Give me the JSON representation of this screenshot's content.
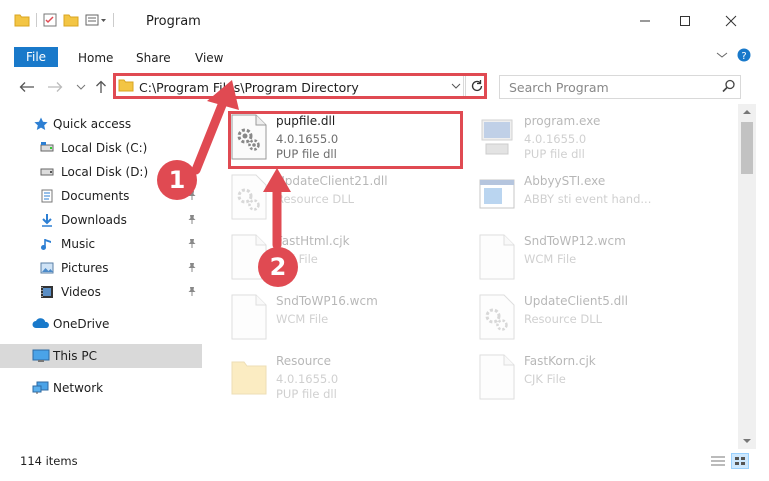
{
  "window": {
    "title": "Program"
  },
  "ribbon": {
    "file_label": "File",
    "tabs": [
      "Home",
      "Share",
      "View"
    ]
  },
  "address": {
    "path": "C:\\Program Files\\Program Directory"
  },
  "search": {
    "placeholder": "Search Program"
  },
  "sidebar": {
    "items": [
      {
        "label": "Quick access",
        "icon": "star-icon"
      },
      {
        "label": "Local Disk (C:)",
        "icon": "drive-icon"
      },
      {
        "label": "Local Disk (D:)",
        "icon": "drive-icon"
      },
      {
        "label": "Documents",
        "icon": "documents-icon"
      },
      {
        "label": "Downloads",
        "icon": "download-icon"
      },
      {
        "label": "Music",
        "icon": "music-icon"
      },
      {
        "label": "Pictures",
        "icon": "pictures-icon"
      },
      {
        "label": "Videos",
        "icon": "videos-icon"
      },
      {
        "label": "OneDrive",
        "icon": "cloud-icon"
      },
      {
        "label": "This PC",
        "icon": "computer-icon"
      },
      {
        "label": "Network",
        "icon": "network-icon"
      }
    ]
  },
  "files": [
    {
      "name": "pupfile.dll",
      "line2": "4.0.1655.0",
      "line3": "PUP file dll",
      "icon": "dll-gear-icon",
      "highlighted": true
    },
    {
      "name": "program.exe",
      "line2": "4.0.1655.0",
      "line3": "PUP file dll",
      "icon": "exe-icon",
      "highlighted": false
    },
    {
      "name": "UpdateClient21.dll",
      "line2": "Resource DLL",
      "line3": "",
      "icon": "dll-gear-icon",
      "highlighted": false
    },
    {
      "name": "AbbyySTI.exe",
      "line2": "ABBY sti event hand...",
      "line3": "",
      "icon": "window-icon",
      "highlighted": false
    },
    {
      "name": "FastHtml.cjk",
      "line2": "CJK File",
      "line3": "",
      "icon": "blank-file-icon",
      "highlighted": false
    },
    {
      "name": "SndToWP12.wcm",
      "line2": "WCM File",
      "line3": "",
      "icon": "blank-file-icon",
      "highlighted": false
    },
    {
      "name": "SndToWP16.wcm",
      "line2": "WCM File",
      "line3": "",
      "icon": "blank-file-icon",
      "highlighted": false
    },
    {
      "name": "UpdateClient5.dll",
      "line2": "Resource DLL",
      "line3": "",
      "icon": "dll-gear-icon",
      "highlighted": false
    },
    {
      "name": "Resource",
      "line2": "4.0.1655.0",
      "line3": "PUP file dll",
      "icon": "folder-icon",
      "highlighted": false
    },
    {
      "name": "FastKorn.cjk",
      "line2": "CJK File",
      "line3": "",
      "icon": "blank-file-icon",
      "highlighted": false
    }
  ],
  "status": {
    "item_count": "114 items"
  },
  "callouts": [
    "1",
    "2"
  ],
  "colors": {
    "accent": "#1979ca",
    "highlight": "#e04a52",
    "selection": "#d9d9d9"
  }
}
